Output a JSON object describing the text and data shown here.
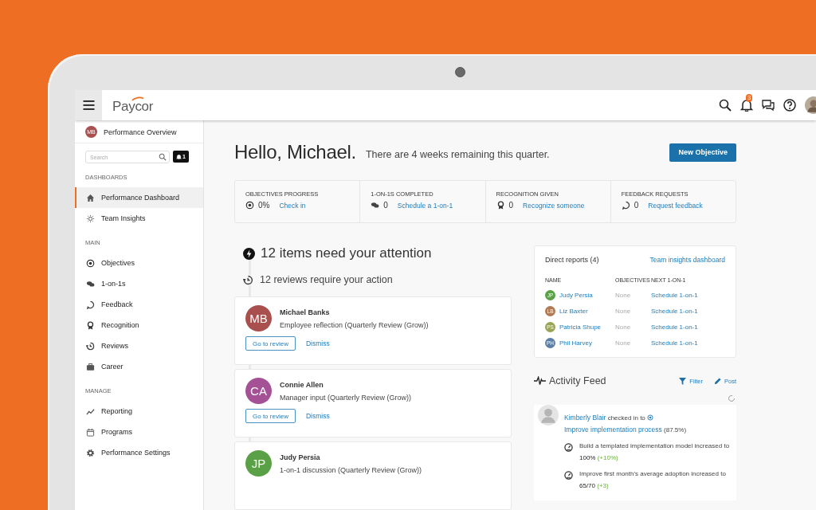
{
  "header": {
    "logo": "Paycor",
    "notifications_badge": "3"
  },
  "sidebar": {
    "overview": {
      "initials": "MB",
      "label": "Performance Overview",
      "color": "#a9504e"
    },
    "search": {
      "placeholder": "Search"
    },
    "alerts_badge": "1",
    "sections": [
      {
        "title": "DASHBOARDS",
        "items": [
          {
            "label": "Performance Dashboard",
            "selected": true
          },
          {
            "label": "Team Insights",
            "selected": false
          }
        ]
      },
      {
        "title": "MAIN",
        "items": [
          {
            "label": "Objectives",
            "selected": false
          },
          {
            "label": "1-on-1s",
            "selected": false
          },
          {
            "label": "Feedback",
            "selected": false
          },
          {
            "label": "Recognition",
            "selected": false
          },
          {
            "label": "Reviews",
            "selected": false
          },
          {
            "label": "Career",
            "selected": false
          }
        ]
      },
      {
        "title": "MANAGE",
        "items": [
          {
            "label": "Reporting",
            "selected": false
          },
          {
            "label": "Programs",
            "selected": false
          },
          {
            "label": "Performance Settings",
            "selected": false
          }
        ]
      }
    ]
  },
  "main": {
    "greeting": "Hello, Michael.",
    "subtitle": "There are 4 weeks remaining this quarter.",
    "new_objective_button": "New Objective",
    "stats": [
      {
        "title": "OBJECTIVES PROGRESS",
        "value": "0%",
        "link": "Check in"
      },
      {
        "title": "1-ON-1S COMPLETED",
        "value": "0",
        "link": "Schedule a 1-on-1"
      },
      {
        "title": "RECOGNITION GIVEN",
        "value": "0",
        "link": "Recognize someone"
      },
      {
        "title": "FEEDBACK REQUESTS",
        "value": "0",
        "link": "Request feedback"
      }
    ],
    "attention": {
      "title": "12 items need your attention",
      "subtitle": "12 reviews require your action"
    },
    "reviews": [
      {
        "initials": "MB",
        "color": "#a9504e",
        "name": "Michael Banks",
        "task": "Employee reflection (Quarterly Review (Grow))",
        "actions": [
          "Go to review",
          "Dismiss"
        ]
      },
      {
        "initials": "CA",
        "color": "#a55196",
        "name": "Connie Allen",
        "task": "Manager input (Quarterly Review (Grow))",
        "actions": [
          "Go to review",
          "Dismiss"
        ]
      },
      {
        "initials": "JP",
        "color": "#5aa046",
        "name": "Judy Persia",
        "task": "1-on-1 discussion (Quarterly Review (Grow))"
      }
    ]
  },
  "direct_reports": {
    "title": "Direct reports (4)",
    "link": "Team insights dashboard",
    "columns": [
      "NAME",
      "OBJECTIVES",
      "NEXT 1-ON-1"
    ],
    "rows": [
      {
        "initials": "JP",
        "color": "#5aa046",
        "name": "Judy Persia",
        "objectives": "None",
        "next": "Schedule 1-on-1"
      },
      {
        "initials": "LB",
        "color": "#b07a55",
        "name": "Liz Baxter",
        "objectives": "None",
        "next": "Schedule 1-on-1"
      },
      {
        "initials": "PS",
        "color": "#9aa356",
        "name": "Patricia Shupe",
        "objectives": "None",
        "next": "Schedule 1-on-1"
      },
      {
        "initials": "PH",
        "color": "#5b7fa6",
        "name": "Phil Harvey",
        "objectives": "None",
        "next": "Schedule 1-on-1"
      }
    ]
  },
  "activity_feed": {
    "title": "Activity Feed",
    "filter": "Filter",
    "post": "Post",
    "entry": {
      "author": "Kimberly Blair",
      "action": "checked in to",
      "objective": "Improve implementation process",
      "percent": "(87.5%)",
      "updates": [
        {
          "text": "Build a templated implementation model increased to",
          "value": "100%",
          "change": "(+10%)"
        },
        {
          "text": "Improve first month's average adoption increased to",
          "value": "65/70",
          "change": "(+3)"
        }
      ]
    }
  }
}
